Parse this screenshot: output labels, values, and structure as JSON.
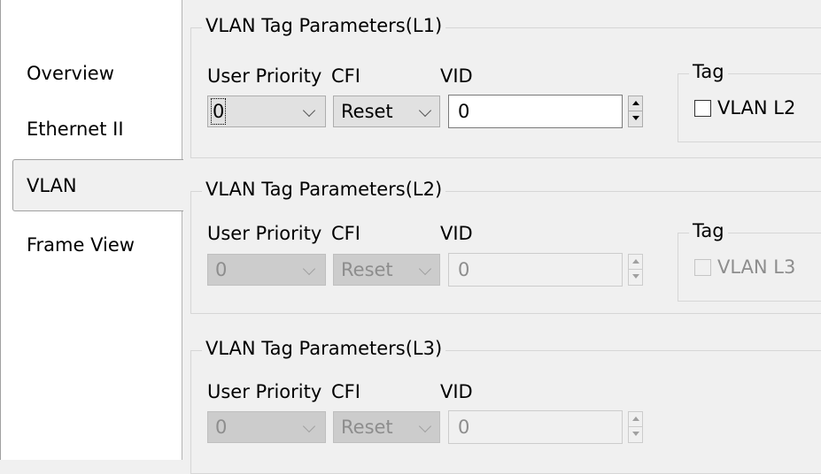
{
  "tabs": [
    {
      "label": "Overview",
      "selected": false
    },
    {
      "label": "Ethernet II",
      "selected": false
    },
    {
      "label": "VLAN",
      "selected": true
    },
    {
      "label": "Frame View",
      "selected": false
    }
  ],
  "groups": [
    {
      "title": "VLAN Tag Parameters(L1)",
      "labels": {
        "user_priority": "User Priority",
        "cfi": "CFI",
        "vid": "VID"
      },
      "user_priority_value": "0",
      "cfi_value": "Reset",
      "vid_value": "0",
      "enabled": true,
      "tag": {
        "title": "Tag",
        "checkbox_label": "VLAN L2",
        "checked": false
      }
    },
    {
      "title": "VLAN Tag Parameters(L2)",
      "labels": {
        "user_priority": "User Priority",
        "cfi": "CFI",
        "vid": "VID"
      },
      "user_priority_value": "0",
      "cfi_value": "Reset",
      "vid_value": "0",
      "enabled": false,
      "tag": {
        "title": "Tag",
        "checkbox_label": "VLAN L3",
        "checked": false
      }
    },
    {
      "title": "VLAN Tag Parameters(L3)",
      "labels": {
        "user_priority": "User Priority",
        "cfi": "CFI",
        "vid": "VID"
      },
      "user_priority_value": "0",
      "cfi_value": "Reset",
      "vid_value": "0",
      "enabled": false
    }
  ]
}
